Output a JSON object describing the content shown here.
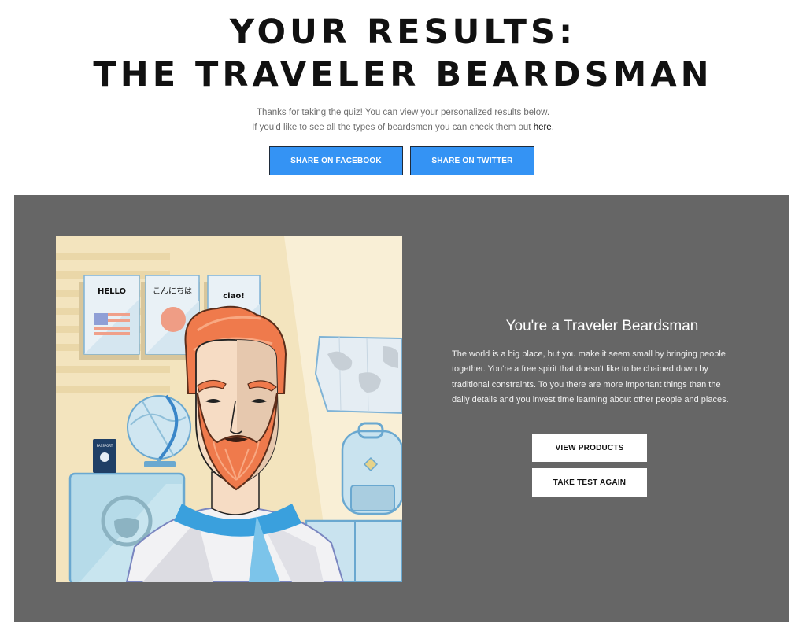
{
  "header": {
    "title_line1": "YOUR RESULTS:",
    "title_line2": "THE TRAVELER BEARDSMAN"
  },
  "intro": {
    "line1": "Thanks for taking the quiz! You can view your personalized results below.",
    "line2_prefix": "If you'd like to see all the types of beardsmen you can check them out ",
    "line2_link": "here",
    "line2_suffix": "."
  },
  "share": {
    "facebook_label": "SHARE ON FACEBOOK",
    "twitter_label": "SHARE ON TWITTER"
  },
  "illustration": {
    "poster_hello": "HELLO",
    "poster_konnichiwa": "こんにちは",
    "poster_ciao": "ciao!",
    "passport_label": "PASSPORT"
  },
  "result": {
    "title": "You're a Traveler Beardsman",
    "description": "The world is a big place, but you make it seem small by bringing people together. You're a free spirit that doesn't like to be chained down by traditional constraints. To you there are more important things than the daily details and you invest time learning about other people and places.",
    "view_products_label": "VIEW  PRODUCTS",
    "take_test_label": "TAKE TEST AGAIN"
  },
  "colors": {
    "share_button": "#3493f4",
    "panel_background": "#666666",
    "beard": "#ef7a4c",
    "illustration_background": "#f3e4be"
  }
}
